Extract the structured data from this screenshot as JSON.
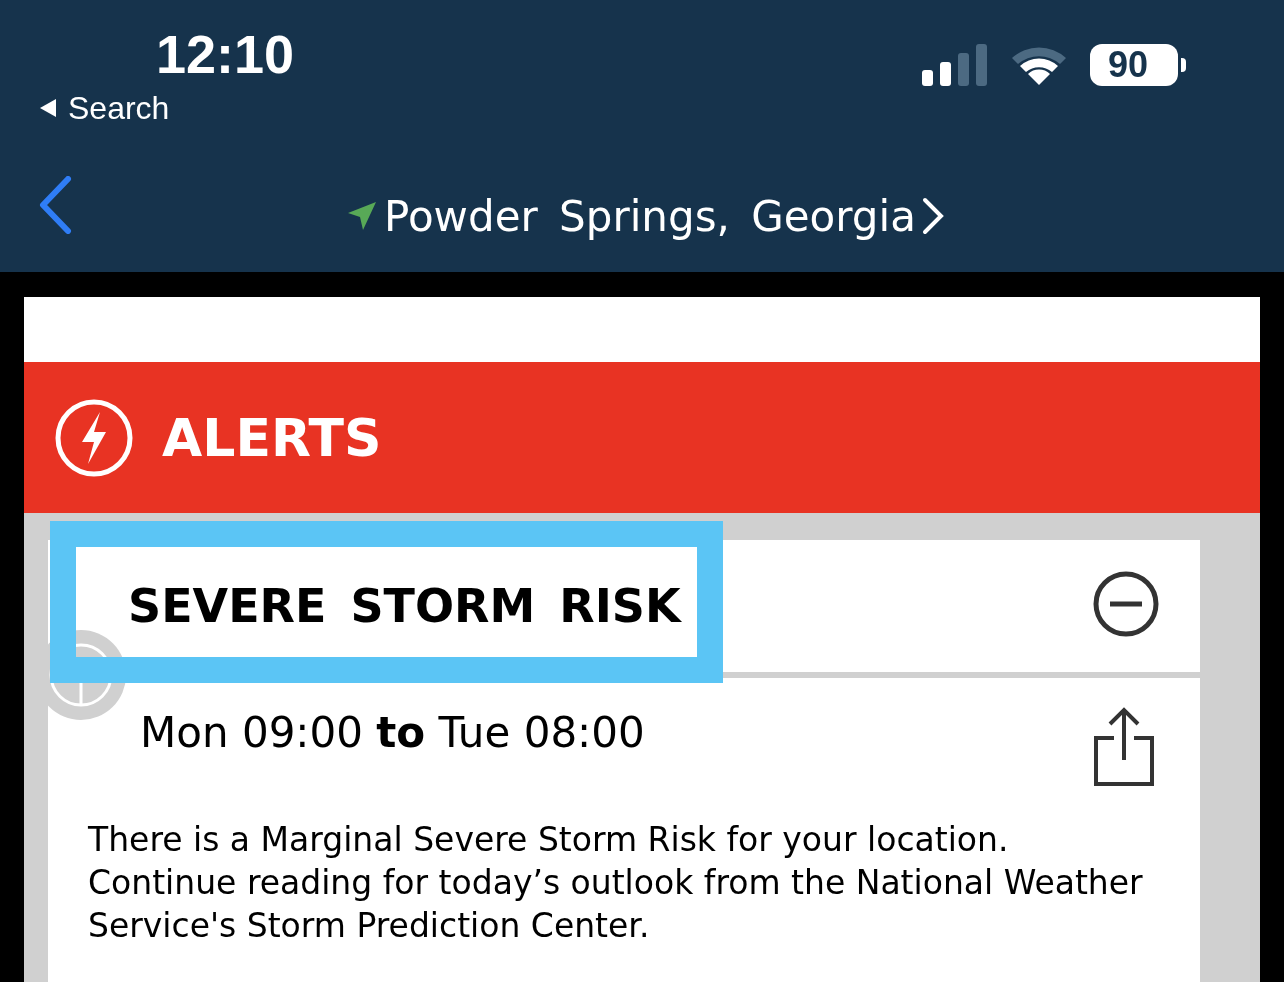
{
  "status_bar": {
    "time": "12:10",
    "back_label": "Search",
    "battery": "90"
  },
  "nav": {
    "location": "Powder Springs, Georgia"
  },
  "banner": {
    "title": "ALERTS"
  },
  "alert": {
    "title": "SEVERE STORM RISK",
    "highlighted": true,
    "expanded": true,
    "period": "Mon 09:00 **to** Tue 08:00",
    "description": "There is a Marginal Severe Storm Risk for your location. Continue reading for today’s outlook from the National Weather Service's Storm Prediction Center."
  }
}
